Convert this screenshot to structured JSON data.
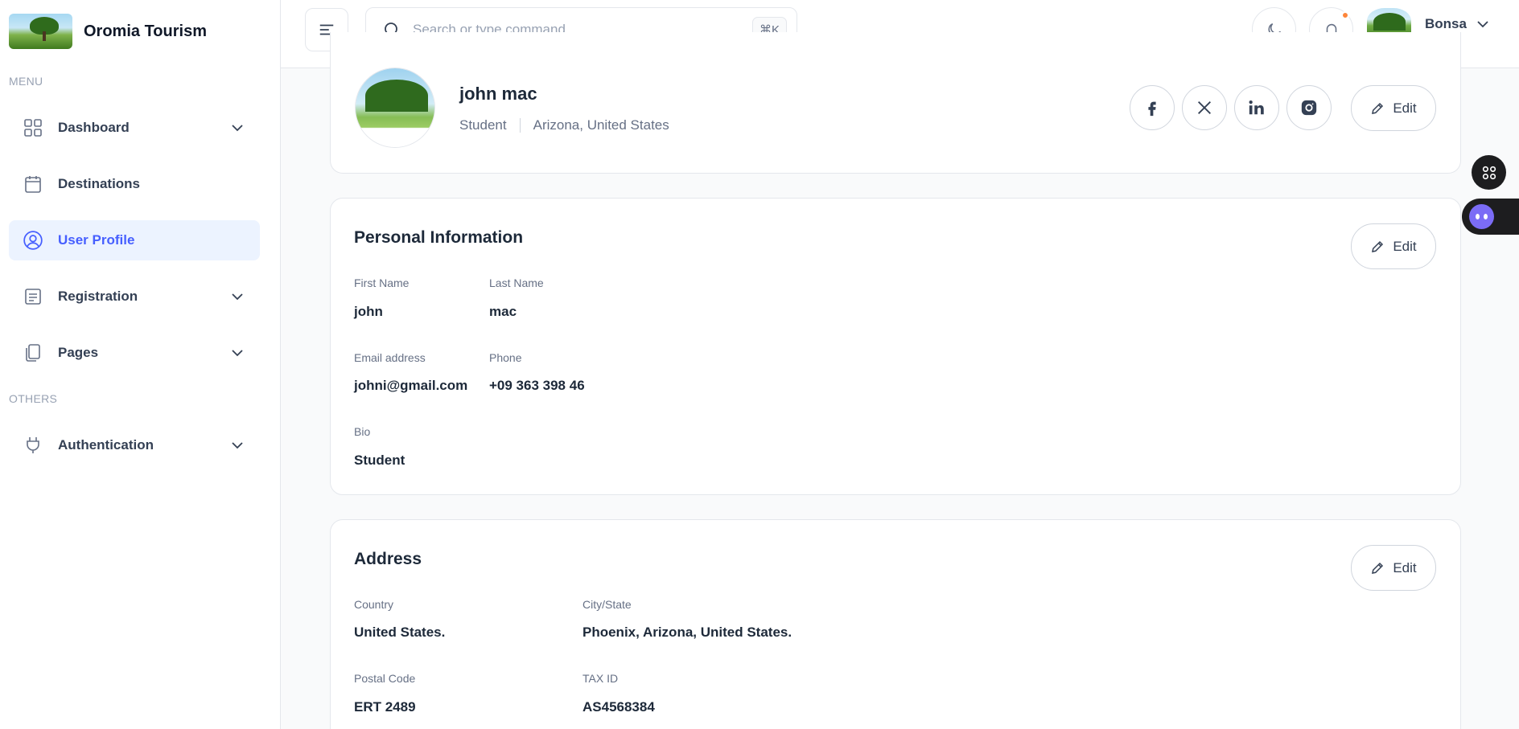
{
  "brand": {
    "name": "Oromia Tourism"
  },
  "sidebar": {
    "menu_label": "MENU",
    "others_label": "OTHERS",
    "items": [
      {
        "label": "Dashboard",
        "icon": "grid-icon",
        "has_chevron": true
      },
      {
        "label": "Destinations",
        "icon": "calendar-icon",
        "has_chevron": false
      },
      {
        "label": "User Profile",
        "icon": "user-circle-icon",
        "has_chevron": false,
        "active": true
      },
      {
        "label": "Registration",
        "icon": "list-icon",
        "has_chevron": true
      },
      {
        "label": "Pages",
        "icon": "pages-icon",
        "has_chevron": true
      },
      {
        "label": "Authentication",
        "icon": "plug-icon",
        "has_chevron": true
      }
    ]
  },
  "header": {
    "search_placeholder": "Search or type command...",
    "search_shortcut": "⌘K",
    "user_name": "Bonsa"
  },
  "profile": {
    "name": "john mac",
    "role": "Student",
    "location": "Arizona, United States",
    "social": [
      "facebook-icon",
      "x-icon",
      "linkedin-icon",
      "instagram-icon"
    ],
    "edit_label": "Edit"
  },
  "personal": {
    "title": "Personal Information",
    "edit_label": "Edit",
    "first_name_label": "First Name",
    "first_name": "john",
    "last_name_label": "Last Name",
    "last_name": "mac",
    "email_label": "Email address",
    "email": "johni@gmail.com",
    "phone_label": "Phone",
    "phone": "+09 363 398 46",
    "bio_label": "Bio",
    "bio": "Student"
  },
  "address": {
    "title": "Address",
    "edit_label": "Edit",
    "country_label": "Country",
    "country": "United States.",
    "city_label": "City/State",
    "city": "Phoenix, Arizona, United States.",
    "postal_label": "Postal Code",
    "postal": "ERT 2489",
    "tax_label": "TAX ID",
    "tax": "AS4568384"
  },
  "colors": {
    "accent": "#465fff",
    "active_bg": "#ecf3ff",
    "notification": "#fd853a"
  }
}
